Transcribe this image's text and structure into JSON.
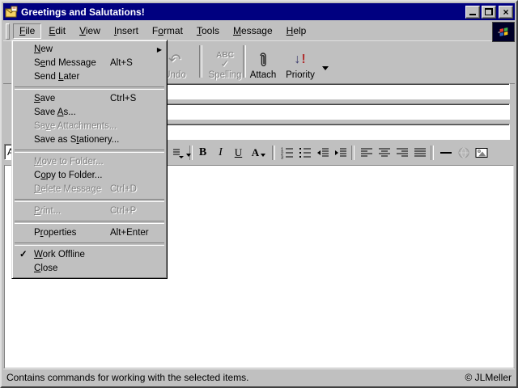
{
  "window": {
    "title": "Greetings and Salutations!"
  },
  "menubar": {
    "items": [
      "&File",
      "&Edit",
      "&View",
      "&Insert",
      "F&ormat",
      "&Tools",
      "&Message",
      "&Help"
    ],
    "active_index": 0
  },
  "toolbar": {
    "buttons": [
      {
        "label": "Undo",
        "icon": "undo-icon",
        "disabled": true
      },
      {
        "label": "Spelling",
        "icon": "spelling-icon",
        "disabled": true
      },
      {
        "label": "Attach",
        "icon": "attach-icon",
        "disabled": false
      },
      {
        "label": "Priority",
        "icon": "priority-icon",
        "disabled": false
      }
    ],
    "spelling_icon_text": "ABC",
    "spelling_icon_check": "✓"
  },
  "file_menu": {
    "items": [
      {
        "label": "&New",
        "submenu": true
      },
      {
        "label": "S&end Message",
        "shortcut": "Alt+S"
      },
      {
        "label": "Send &Later"
      },
      {
        "separator": true
      },
      {
        "label": "&Save",
        "shortcut": "Ctrl+S"
      },
      {
        "label": "Save &As..."
      },
      {
        "label": "Sa&ve Attachments...",
        "disabled": true
      },
      {
        "label": "Save as S&tationery..."
      },
      {
        "separator": true
      },
      {
        "label": "&Move to Folder...",
        "disabled": true
      },
      {
        "label": "C&opy to Folder..."
      },
      {
        "label": "&Delete Message",
        "shortcut": "Ctrl+D",
        "disabled": true
      },
      {
        "separator": true
      },
      {
        "label": "&Print...",
        "shortcut": "Ctrl+P",
        "disabled": true
      },
      {
        "separator": true
      },
      {
        "label": "P&roperties",
        "shortcut": "Alt+Enter"
      },
      {
        "separator": true
      },
      {
        "label": "&Work Offline",
        "checked": true
      },
      {
        "label": "&Close"
      }
    ],
    "check_glyph": "✓",
    "submenu_glyph": "▶"
  },
  "fields": {
    "field1": "",
    "field2": "",
    "field3": ""
  },
  "format_toolbar": {
    "font_box_text": "A",
    "buttons": [
      {
        "icon": "paragraph-style-icon"
      },
      {
        "icon": "bold-icon",
        "label": "B"
      },
      {
        "icon": "italic-icon",
        "label": "I"
      },
      {
        "icon": "underline-icon",
        "label": "U"
      },
      {
        "icon": "font-color-icon",
        "label": "A"
      },
      {
        "icon": "numbered-list-icon"
      },
      {
        "icon": "bullet-list-icon"
      },
      {
        "icon": "decrease-indent-icon"
      },
      {
        "icon": "increase-indent-icon"
      },
      {
        "icon": "align-left-icon"
      },
      {
        "icon": "align-center-icon"
      },
      {
        "icon": "align-right-icon"
      },
      {
        "icon": "justify-icon"
      },
      {
        "icon": "horizontal-line-icon"
      },
      {
        "icon": "hyperlink-icon",
        "disabled": true
      },
      {
        "icon": "insert-picture-icon"
      }
    ]
  },
  "statusbar": {
    "text": "Contains commands for working with the selected items.",
    "credit": "© JLMeller"
  },
  "colors": {
    "titlebar": "#000080",
    "chrome": "#c0c0c0",
    "priority_arrow": "#3b3b6d",
    "priority_excl": "#b03030"
  }
}
